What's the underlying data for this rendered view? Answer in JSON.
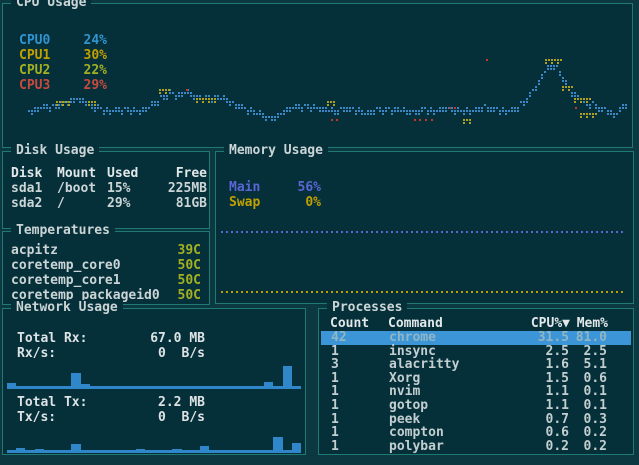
{
  "theme": {
    "bg_outer": "#0c3842",
    "bg_panel": "#05303a",
    "border": "#1f7a74",
    "text": "#ccd5d6"
  },
  "cpu": {
    "title": "CPU Usage",
    "cores": [
      {
        "label": "CPU0",
        "value": "24%",
        "color": "#3194d0"
      },
      {
        "label": "CPU1",
        "value": "30%",
        "color": "#c3a000"
      },
      {
        "label": "CPU2",
        "value": "22%",
        "color": "#a3b021"
      },
      {
        "label": "CPU3",
        "value": "29%",
        "color": "#c84a3e"
      }
    ],
    "graph": {
      "line_color": "#3a87c8",
      "accent_yellow": "#b0a020",
      "accent_red": "#c0392b",
      "blue_points": [
        [
          3,
          74
        ],
        [
          5.5,
          70
        ],
        [
          8,
          67
        ],
        [
          9.5,
          63
        ],
        [
          11,
          59
        ],
        [
          12.5,
          63
        ],
        [
          14,
          69
        ],
        [
          16.5,
          74
        ],
        [
          19,
          72
        ],
        [
          21.5,
          74
        ],
        [
          23,
          68
        ],
        [
          24.7,
          58
        ],
        [
          26,
          52
        ],
        [
          27.5,
          54
        ],
        [
          28.8,
          51
        ],
        [
          30.3,
          56
        ],
        [
          31.9,
          58
        ],
        [
          33.5,
          56
        ],
        [
          35.1,
          60
        ],
        [
          36.7,
          66
        ],
        [
          38.3,
          72
        ],
        [
          39.9,
          76
        ],
        [
          41.2,
          80
        ],
        [
          42.3,
          83
        ],
        [
          43.6,
          79
        ],
        [
          44.7,
          74
        ],
        [
          46.3,
          70
        ],
        [
          47.9,
          67
        ],
        [
          49.5,
          69
        ],
        [
          51.1,
          72
        ],
        [
          52.7,
          74
        ],
        [
          54.3,
          71
        ],
        [
          55.9,
          73
        ],
        [
          57.5,
          76
        ],
        [
          58.9,
          72
        ],
        [
          60.7,
          74
        ],
        [
          62.3,
          71
        ],
        [
          63.9,
          73
        ],
        [
          65.5,
          75
        ],
        [
          67.1,
          72
        ],
        [
          68.5,
          74
        ],
        [
          70.3,
          70
        ],
        [
          71.9,
          72
        ],
        [
          73.5,
          75
        ],
        [
          75.1,
          72
        ],
        [
          76.7,
          69
        ],
        [
          78.3,
          72
        ],
        [
          79.9,
          74
        ],
        [
          81.5,
          71
        ],
        [
          82.7,
          66
        ],
        [
          84,
          56
        ],
        [
          85.3,
          40
        ],
        [
          86.6,
          24
        ],
        [
          87.7,
          15
        ],
        [
          88.5,
          22
        ],
        [
          89.5,
          34
        ],
        [
          90.3,
          46
        ],
        [
          91.5,
          56
        ],
        [
          92.8,
          62
        ],
        [
          94,
          66
        ],
        [
          95.3,
          70
        ],
        [
          96.6,
          74
        ],
        [
          97.8,
          78
        ],
        [
          98.7,
          70
        ],
        [
          99.7,
          64
        ]
      ],
      "yellow_runs": [
        [
          7.9,
          10.3,
          65
        ],
        [
          13.1,
          14.3,
          64
        ],
        [
          24.4,
          26.3,
          50
        ],
        [
          30.4,
          33.5,
          60
        ],
        [
          51.6,
          53,
          64
        ],
        [
          73.5,
          74.6,
          87
        ],
        [
          86.6,
          89.2,
          10
        ],
        [
          89.4,
          91.3,
          45
        ],
        [
          91.3,
          93.8,
          60
        ],
        [
          92.2,
          94.8,
          80
        ]
      ],
      "red_dots": [
        [
          28.8,
          50
        ],
        [
          52.2,
          87
        ],
        [
          53,
          87
        ],
        [
          65.5,
          87
        ],
        [
          66.4,
          87
        ],
        [
          67.3,
          87
        ],
        [
          68.2,
          87
        ],
        [
          71.2,
          71
        ],
        [
          72,
          71
        ],
        [
          77.2,
          10
        ],
        [
          91.5,
          73
        ]
      ]
    }
  },
  "disk": {
    "title": "Disk Usage",
    "headers": [
      "Disk",
      "Mount",
      "Used",
      "Free"
    ],
    "rows": [
      [
        "sda1",
        "/boot",
        "15%",
        "225MB"
      ],
      [
        "sda2",
        "/",
        "29%",
        "81GB"
      ]
    ]
  },
  "temperatures": {
    "title": "Temperatures",
    "value_color": "#a3b021",
    "rows": [
      [
        "acpitz",
        "39C"
      ],
      [
        "coretemp_core0",
        "50C"
      ],
      [
        "coretemp_core1",
        "50C"
      ],
      [
        "coretemp_packageid0",
        "50C"
      ]
    ]
  },
  "memory": {
    "title": "Memory Usage",
    "main": {
      "label": "Main",
      "value": "56%",
      "color": "#5b66d6",
      "line_pct": 52
    },
    "swap": {
      "label": "Swap",
      "value": "0%",
      "color": "#c0a000",
      "line_pct": 92
    }
  },
  "network": {
    "title": "Network Usage",
    "rx": {
      "total_label": "Total Rx:",
      "total": "67.0 MB",
      "rate_label": "Rx/s:",
      "rate": "0  B/s",
      "color": "#2f86c9",
      "bars": [
        25,
        8,
        8,
        8,
        8,
        8,
        8,
        60,
        20,
        8,
        8,
        8,
        8,
        8,
        8,
        8,
        8,
        8,
        8,
        8,
        8,
        8,
        8,
        8,
        8,
        8,
        8,
        8,
        28,
        8,
        88,
        8
      ]
    },
    "tx": {
      "total_label": "Total Tx:",
      "total": "2.2 MB",
      "rate_label": "Tx/s:",
      "rate": "0  B/s",
      "color": "#2f86c9",
      "bars": [
        8,
        18,
        8,
        14,
        8,
        8,
        8,
        32,
        8,
        8,
        8,
        8,
        8,
        8,
        14,
        8,
        8,
        8,
        14,
        8,
        8,
        25,
        8,
        8,
        8,
        8,
        8,
        8,
        8,
        57,
        8,
        36
      ]
    }
  },
  "processes": {
    "title": "Processes",
    "headers": [
      "Count",
      "Command",
      "CPU%▼",
      "Mem%"
    ],
    "selected_index": 0,
    "selected_bg": "#3c95d6",
    "rows": [
      [
        "42",
        "chrome",
        "31.5",
        "81.0"
      ],
      [
        "1",
        "insync",
        "2.5",
        "2.5"
      ],
      [
        "3",
        "alacritty",
        "1.6",
        "5.1"
      ],
      [
        "1",
        "Xorg",
        "1.5",
        "0.6"
      ],
      [
        "1",
        "nvim",
        "1.1",
        "0.1"
      ],
      [
        "1",
        "gotop",
        "1.1",
        "0.1"
      ],
      [
        "1",
        "peek",
        "0.7",
        "0.3"
      ],
      [
        "1",
        "compton",
        "0.6",
        "0.2"
      ],
      [
        "1",
        "polybar",
        "0.2",
        "0.2"
      ]
    ]
  }
}
